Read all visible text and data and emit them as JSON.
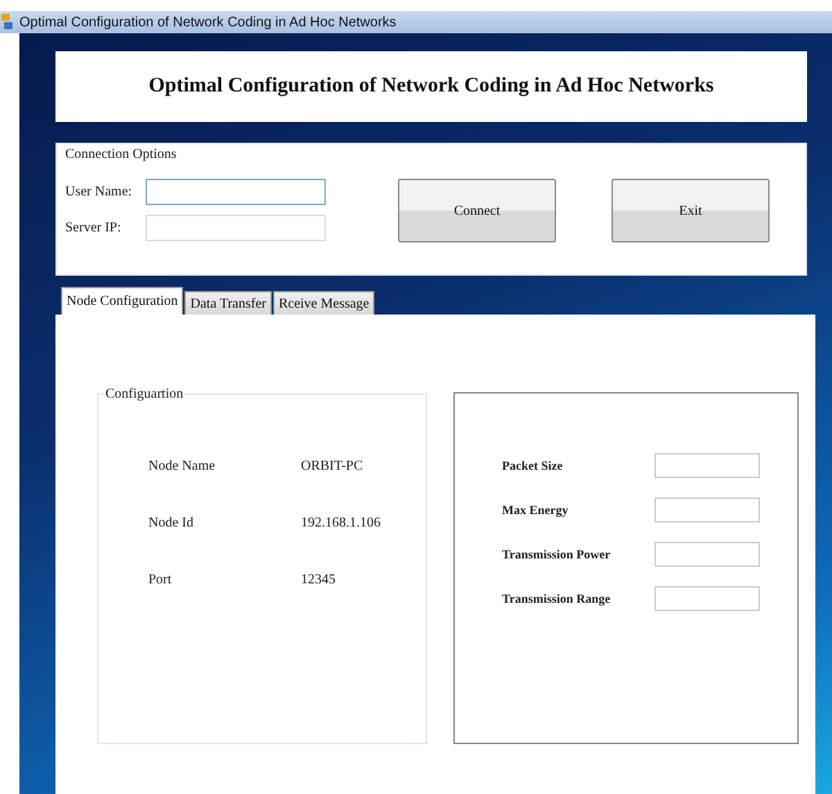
{
  "window": {
    "title": "Optimal Configuration of Network Coding in Ad Hoc Networks"
  },
  "header": {
    "title": "Optimal Configuration of Network Coding in Ad Hoc Networks"
  },
  "connection_options": {
    "legend": "Connection Options",
    "fields": [
      {
        "label": "User Name:",
        "focused": true
      },
      {
        "label": "Server IP:",
        "focused": false
      }
    ],
    "buttons": [
      "Connect",
      "Exit"
    ]
  },
  "tabs": [
    {
      "label": "Node Configuration",
      "selected": true
    },
    {
      "label": "Data Transfer",
      "selected": false
    },
    {
      "label": "Rceive Message",
      "selected": false
    }
  ],
  "configuration": {
    "legend": "Configuartion",
    "rows": [
      {
        "label": "Node Name",
        "value": "ORBIT-PC"
      },
      {
        "label": "Node Id",
        "value": "192.168.1.106"
      },
      {
        "label": "Port",
        "value": "12345"
      }
    ]
  },
  "parameters": [
    {
      "label": "Packet Size"
    },
    {
      "label": "Max Energy"
    },
    {
      "label": "Transmission Power"
    },
    {
      "label": "Transmission Range"
    }
  ]
}
